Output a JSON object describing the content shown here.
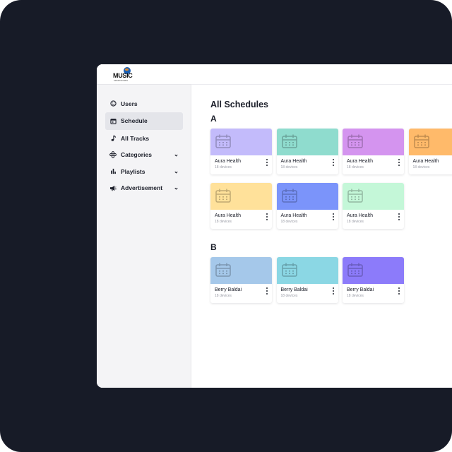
{
  "logo": {
    "word": "MUSIC",
    "sub": "SMARTSTORES"
  },
  "sidebar": {
    "items": [
      {
        "label": "Users",
        "icon": "smiley-icon",
        "active": false,
        "chevron": false
      },
      {
        "label": "Schedule",
        "icon": "calendar-icon",
        "active": true,
        "chevron": false
      },
      {
        "label": "All Tracks",
        "icon": "music-note-icon",
        "active": false,
        "chevron": false
      },
      {
        "label": "Categories",
        "icon": "categories-icon",
        "active": false,
        "chevron": true
      },
      {
        "label": "Playlists",
        "icon": "bar-chart-icon",
        "active": false,
        "chevron": true
      },
      {
        "label": "Advertisement",
        "icon": "megaphone-icon",
        "active": false,
        "chevron": true
      }
    ]
  },
  "main": {
    "title": "All Schedules",
    "groups": [
      {
        "label": "A",
        "cards": [
          {
            "name": "Aura Health",
            "devices": "18 devices",
            "color": "#c3bbfb"
          },
          {
            "name": "Aura Health",
            "devices": "18 devices",
            "color": "#8fdcce"
          },
          {
            "name": "Aura Health",
            "devices": "18 devices",
            "color": "#d494ef"
          },
          {
            "name": "Aura Health",
            "devices": "18 devices",
            "color": "#ffba6a"
          },
          {
            "name": "Aura Health",
            "devices": "18 devices",
            "color": "#ffe19a"
          },
          {
            "name": "Aura Health",
            "devices": "18 devices",
            "color": "#7b94fa"
          },
          {
            "name": "Aura Health",
            "devices": "18 devices",
            "color": "#c4f7d8"
          }
        ]
      },
      {
        "label": "B",
        "cards": [
          {
            "name": "Berry Baldai",
            "devices": "18 devices",
            "color": "#a5c8ea"
          },
          {
            "name": "Berry Baldai",
            "devices": "18 devices",
            "color": "#8bd7e4"
          },
          {
            "name": "Berry Baldai",
            "devices": "18 devices",
            "color": "#8c7bfa"
          }
        ]
      }
    ]
  }
}
